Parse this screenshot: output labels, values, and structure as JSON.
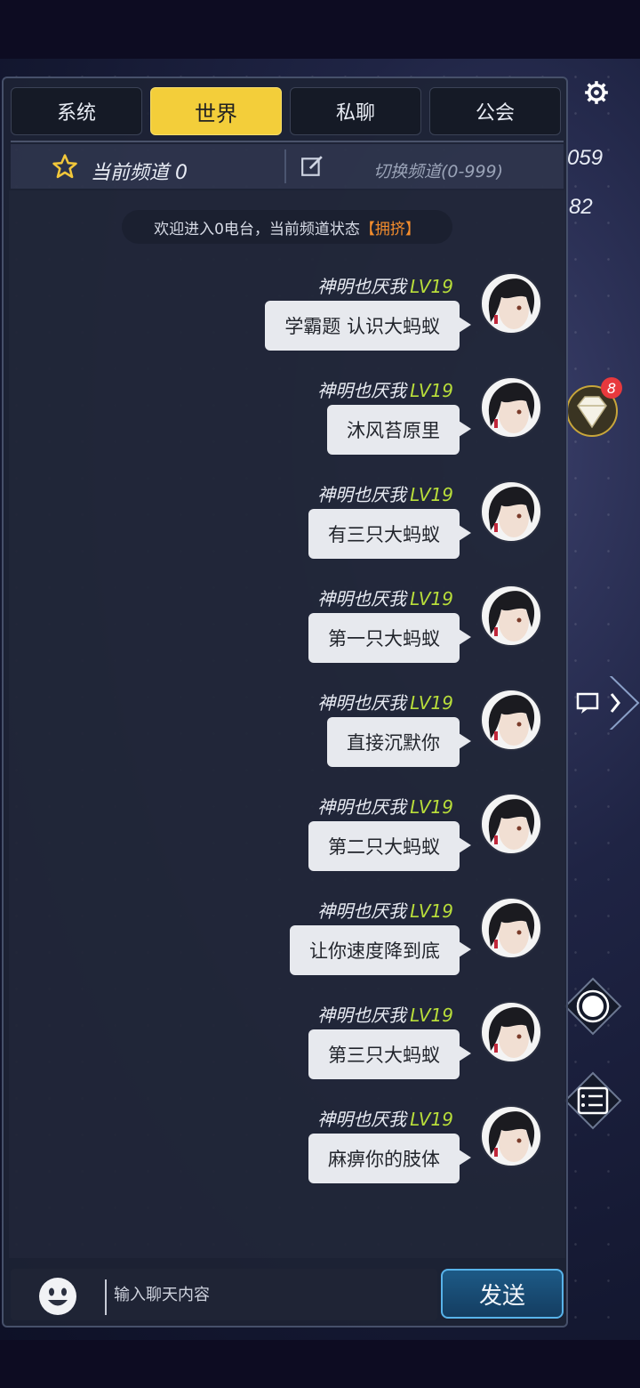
{
  "hud": {
    "gold": "059",
    "gems": "82",
    "gift_badge": "8",
    "icons": [
      "gear-icon",
      "gem-icon",
      "chat-icon",
      "orbit-icon",
      "list-icon"
    ]
  },
  "tabs": [
    {
      "label": "系统",
      "active": false
    },
    {
      "label": "世界",
      "active": true
    },
    {
      "label": "私聊",
      "active": false
    },
    {
      "label": "公会",
      "active": false
    }
  ],
  "channel": {
    "current_label": "当前频道 0",
    "switch_label": "切换频道(0-999)"
  },
  "notice": {
    "text": "欢迎进入0电台，当前频道状态",
    "status": "【拥挤】"
  },
  "messages": [
    {
      "sender": "神明也厌我",
      "level": "LV19",
      "text": "学霸题 认识大蚂蚁"
    },
    {
      "sender": "神明也厌我",
      "level": "LV19",
      "text": "沐风苔原里"
    },
    {
      "sender": "神明也厌我",
      "level": "LV19",
      "text": "有三只大蚂蚁"
    },
    {
      "sender": "神明也厌我",
      "level": "LV19",
      "text": "第一只大蚂蚁"
    },
    {
      "sender": "神明也厌我",
      "level": "LV19",
      "text": "直接沉默你"
    },
    {
      "sender": "神明也厌我",
      "level": "LV19",
      "text": "第二只大蚂蚁"
    },
    {
      "sender": "神明也厌我",
      "level": "LV19",
      "text": "让你速度降到底"
    },
    {
      "sender": "神明也厌我",
      "level": "LV19",
      "text": "第三只大蚂蚁"
    },
    {
      "sender": "神明也厌我",
      "level": "LV19",
      "text": "麻痹你的肢体"
    }
  ],
  "input": {
    "placeholder": "输入聊天内容"
  },
  "send_label": "发送",
  "colors": {
    "active_tab": "#f3ce3a",
    "level": "#b9de3a",
    "status": "#f48d2d",
    "send": "#1d5a86"
  }
}
